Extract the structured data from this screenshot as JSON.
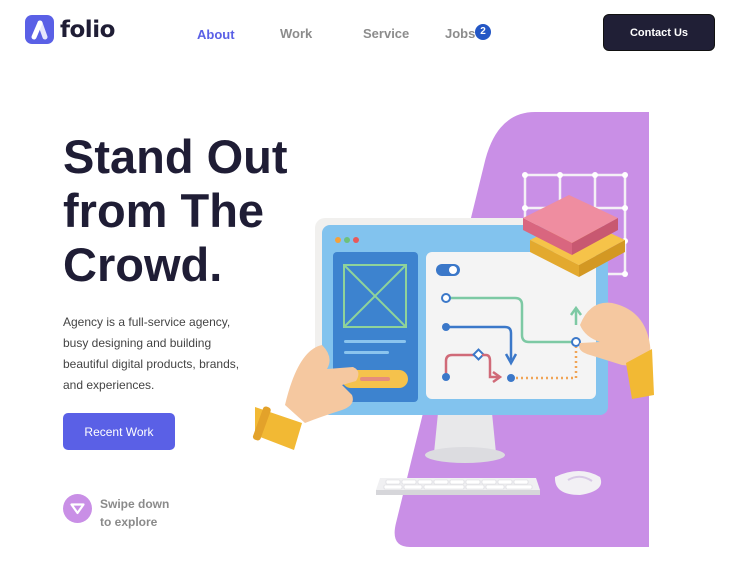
{
  "brand": {
    "name": "folio",
    "accent": "#5a60e6",
    "dark": "#201f36",
    "purple": "#c98fe6"
  },
  "nav": {
    "items": [
      {
        "label": "About",
        "active": true
      },
      {
        "label": "Work",
        "active": false
      },
      {
        "label": "Service",
        "active": false
      },
      {
        "label": "Jobs",
        "active": false,
        "badge": "2"
      }
    ]
  },
  "header": {
    "contact_label": "Contact Us"
  },
  "hero": {
    "title_lines": [
      "Stand Out",
      "from The",
      "Crowd."
    ],
    "description_lines": [
      "Agency is a full-service agency,",
      "busy designing and building",
      "beautiful digital products, brands,",
      "and experiences."
    ],
    "cta_label": "Recent Work"
  },
  "scroll_hint": {
    "lines": [
      "Swipe down",
      "to explore"
    ],
    "icon": "chevron-down-icon"
  },
  "illustration": {
    "icon": "computer-hands-illustration"
  }
}
